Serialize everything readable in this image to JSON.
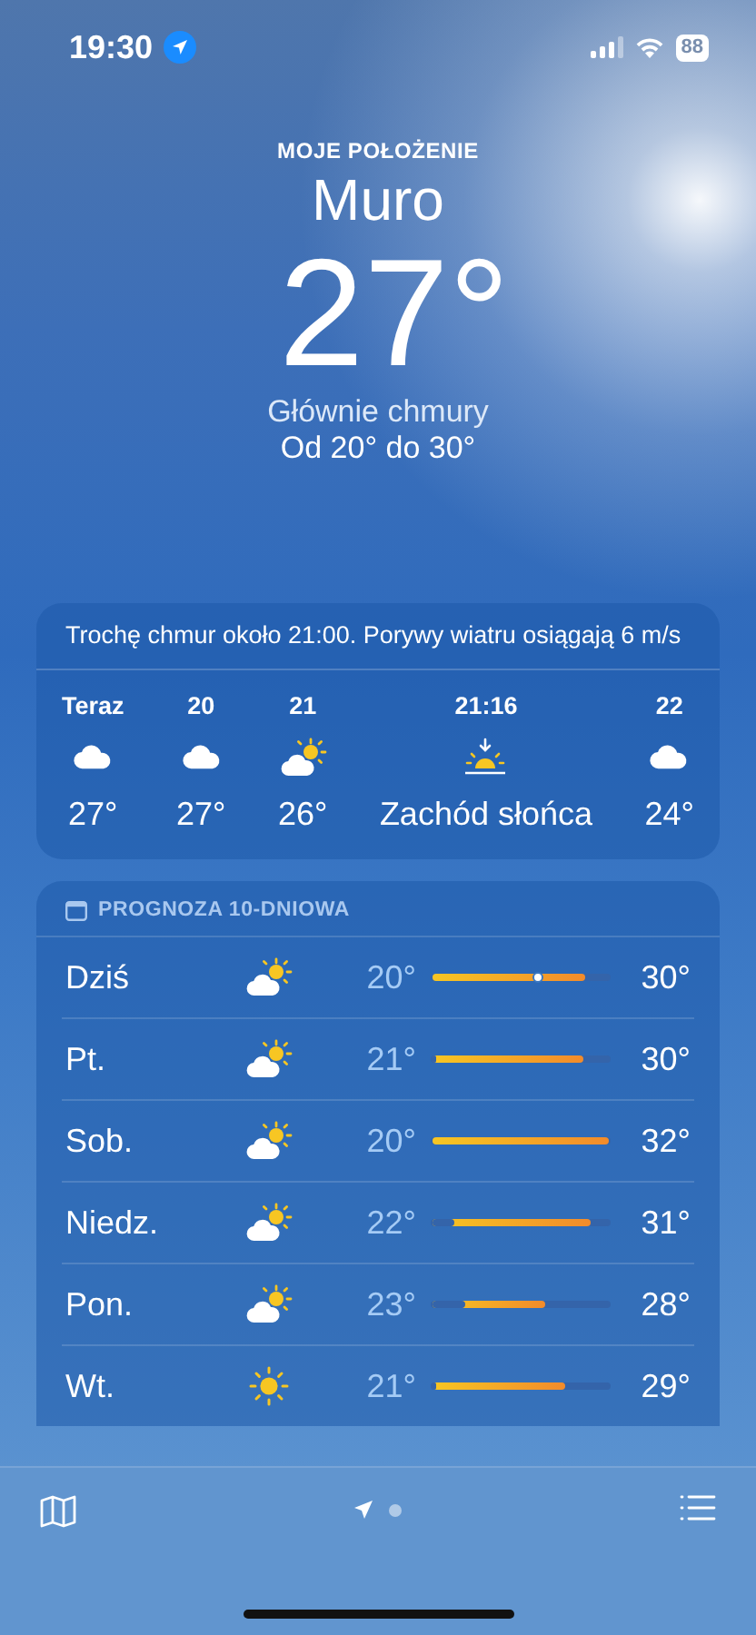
{
  "status_bar": {
    "time": "19:30",
    "battery": "88"
  },
  "header": {
    "caption": "MOJE POŁOŻENIE",
    "city": "Muro",
    "temperature": "27°",
    "condition": "Głównie chmury",
    "range": "Od 20° do 30°"
  },
  "hourly": {
    "summary": "Trochę chmur około 21:00. Porywy wiatru osiągają 6 m/s",
    "items": [
      {
        "time": "Teraz",
        "kind": "cloud",
        "value": "27°"
      },
      {
        "time": "20",
        "kind": "cloud",
        "value": "27°"
      },
      {
        "time": "21",
        "kind": "partly-sunny",
        "value": "26°"
      },
      {
        "time": "21:16",
        "kind": "sunset",
        "value": "Zachód słońca"
      },
      {
        "time": "22",
        "kind": "cloud",
        "value": "24°"
      }
    ]
  },
  "forecast": {
    "title": "PROGNOZA 10-DNIOWA",
    "days": [
      {
        "day": "Dziś",
        "kind": "partly-sunny",
        "low": "20°",
        "high": "30°",
        "bar": {
          "end": {
            "level": 0.87
          }
        },
        "now_marker": {
          "level": 0.6
        }
      },
      {
        "day": "Pt.",
        "kind": "partly-sunny",
        "low": "21°",
        "high": "30°",
        "bar": {
          "start": {
            "level": 0.02
          },
          "end": {
            "level": 0.86
          }
        }
      },
      {
        "day": "Sob.",
        "kind": "partly-sunny",
        "low": "20°",
        "high": "32°",
        "bar": {
          "end": {
            "level": 1
          }
        }
      },
      {
        "day": "Niedz.",
        "kind": "partly-sunny",
        "low": "22°",
        "high": "31°",
        "bar": {
          "start": {
            "level": 0.12
          },
          "end": {
            "level": 0.9
          }
        }
      },
      {
        "day": "Pon.",
        "kind": "partly-sunny",
        "low": "23°",
        "high": "28°",
        "bar": {
          "start": {
            "level": 0.19
          },
          "end": {
            "level": 0.64
          }
        }
      },
      {
        "day": "Wt.",
        "kind": "sun",
        "low": "21°",
        "high": "29°",
        "bar": {
          "start": {
            "level": 0.02
          },
          "end": {
            "level": 0.75
          }
        }
      }
    ]
  },
  "page_dots": [
    {
      "kind": "location",
      "selected": true
    },
    {
      "kind": "dot",
      "selected": false
    }
  ]
}
